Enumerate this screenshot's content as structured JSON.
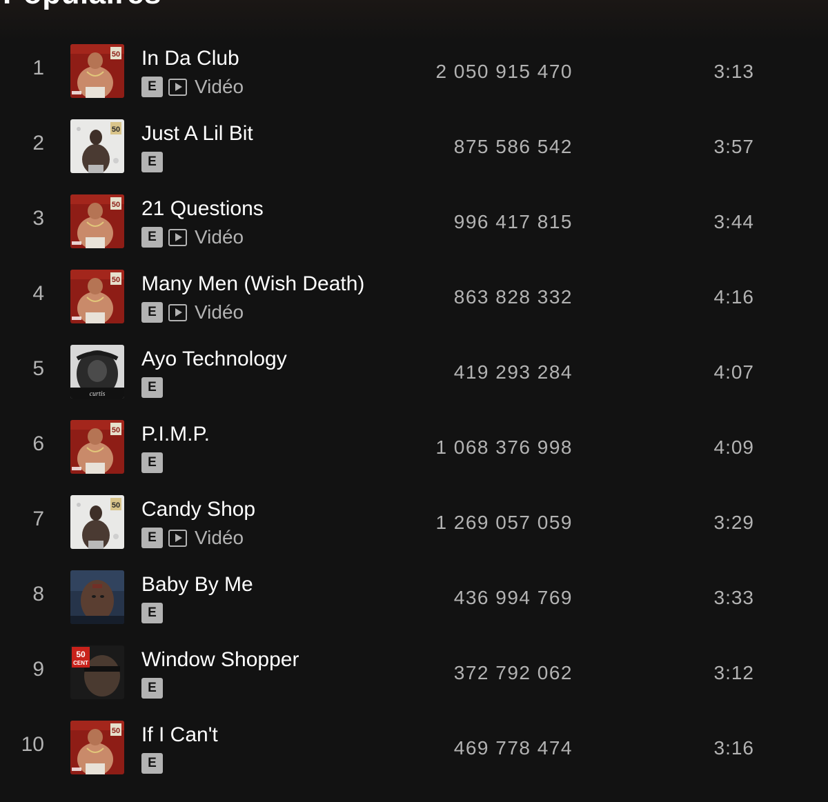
{
  "section": {
    "title": "Populaires"
  },
  "tracks": [
    {
      "rank": "1",
      "title": "In Da Club",
      "explicit": "E",
      "video_label": "Vidéo",
      "has_video": true,
      "plays": "2 050 915 470",
      "duration": "3:13",
      "cover": "album-red"
    },
    {
      "rank": "2",
      "title": "Just A Lil Bit",
      "explicit": "E",
      "video_label": "",
      "has_video": false,
      "plays": "875 586 542",
      "duration": "3:57",
      "cover": "album-white"
    },
    {
      "rank": "3",
      "title": "21 Questions",
      "explicit": "E",
      "video_label": "Vidéo",
      "has_video": true,
      "plays": "996 417 815",
      "duration": "3:44",
      "cover": "album-red"
    },
    {
      "rank": "4",
      "title": "Many Men (Wish Death)",
      "explicit": "E",
      "video_label": "Vidéo",
      "has_video": true,
      "plays": "863 828 332",
      "duration": "4:16",
      "cover": "album-red"
    },
    {
      "rank": "5",
      "title": "Ayo Technology",
      "explicit": "E",
      "video_label": "",
      "has_video": false,
      "plays": "419 293 284",
      "duration": "4:07",
      "cover": "album-bw"
    },
    {
      "rank": "6",
      "title": "P.I.M.P.",
      "explicit": "E",
      "video_label": "",
      "has_video": false,
      "plays": "1 068 376 998",
      "duration": "4:09",
      "cover": "album-red"
    },
    {
      "rank": "7",
      "title": "Candy Shop",
      "explicit": "E",
      "video_label": "Vidéo",
      "has_video": true,
      "plays": "1 269 057 059",
      "duration": "3:29",
      "cover": "album-white"
    },
    {
      "rank": "8",
      "title": "Baby By Me",
      "explicit": "E",
      "video_label": "",
      "has_video": false,
      "plays": "436 994 769",
      "duration": "3:33",
      "cover": "album-blue"
    },
    {
      "rank": "9",
      "title": "Window Shopper",
      "explicit": "E",
      "video_label": "",
      "has_video": false,
      "plays": "372 792 062",
      "duration": "3:12",
      "cover": "album-dark"
    },
    {
      "rank": "10",
      "title": "If I Can't",
      "explicit": "E",
      "video_label": "",
      "has_video": false,
      "plays": "469 778 474",
      "duration": "3:16",
      "cover": "album-red"
    }
  ],
  "colors": {
    "background": "#121212",
    "text_primary": "#ffffff",
    "text_secondary": "#b3b3b3"
  }
}
